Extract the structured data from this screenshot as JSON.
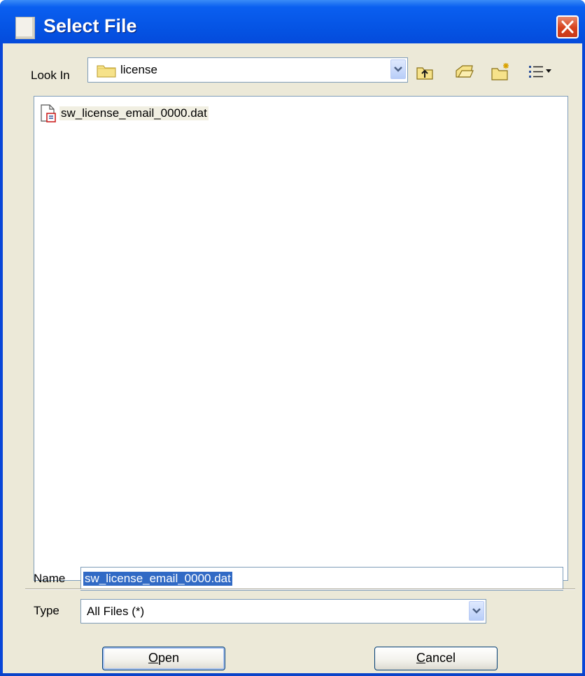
{
  "window": {
    "title": "Select File"
  },
  "toolbar": {
    "look_in_label": "Look In",
    "look_in_value": "license",
    "up_icon": "folder-up-icon",
    "home_icon": "home-folder-icon",
    "new_folder_icon": "new-folder-icon",
    "view_menu_icon": "list-view-icon"
  },
  "files": [
    {
      "name": "sw_license_email_0000.dat",
      "icon": "file-icon"
    }
  ],
  "name_field": {
    "label": "Name",
    "value": "sw_license_email_0000.dat"
  },
  "type_field": {
    "label": "Type",
    "value": "All Files (*)"
  },
  "buttons": {
    "open": "Open",
    "cancel": "Cancel"
  },
  "colors": {
    "title_bar": "#0553e3",
    "dialog_bg": "#ece9d8",
    "selection": "#316ac5",
    "close": "#d6411c"
  }
}
